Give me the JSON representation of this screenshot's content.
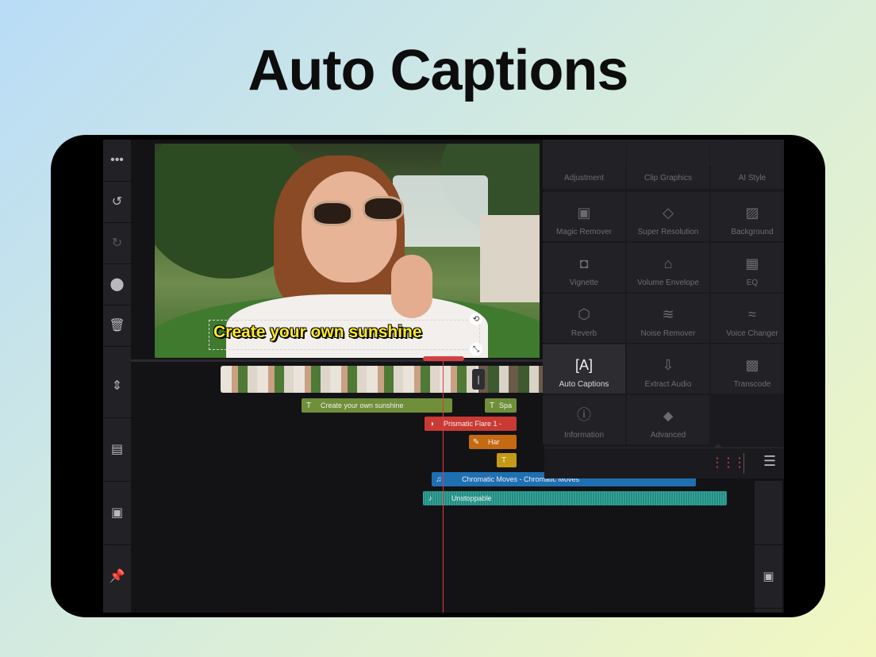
{
  "headline": "Auto Captions",
  "preview": {
    "caption": "Create your own sunshine"
  },
  "timeline": {
    "text_clip_1": "Create your own sunshine",
    "text_clip_2": "Spa",
    "effect_clip_1": "Prismatic Flare 1 -",
    "effect_clip_2": "Har",
    "audio_clip_1": "Chromatic Moves - Chromatic Moves",
    "audio_clip_2": "Unstoppable"
  },
  "panel": {
    "items": [
      {
        "label": "Adjustment",
        "icon": "adjustment-icon"
      },
      {
        "label": "Clip Graphics",
        "icon": "clip-graphics-icon"
      },
      {
        "label": "AI Style",
        "icon": "ai-style-icon"
      },
      {
        "label": "Magic Remover",
        "icon": "magic-remover-icon"
      },
      {
        "label": "Super Resolution",
        "icon": "super-resolution-icon"
      },
      {
        "label": "Background",
        "icon": "background-icon"
      },
      {
        "label": "Vignette",
        "icon": "vignette-icon"
      },
      {
        "label": "Volume Envelope",
        "icon": "volume-envelope-icon"
      },
      {
        "label": "EQ",
        "icon": "eq-icon"
      },
      {
        "label": "Reverb",
        "icon": "reverb-icon"
      },
      {
        "label": "Noise Remover",
        "icon": "noise-remover-icon"
      },
      {
        "label": "Voice Changer",
        "icon": "voice-changer-icon"
      },
      {
        "label": "Auto Captions",
        "icon": "auto-captions-icon"
      },
      {
        "label": "Extract Audio",
        "icon": "extract-audio-icon"
      },
      {
        "label": "Transcode",
        "icon": "transcode-icon"
      },
      {
        "label": "Information",
        "icon": "information-icon"
      },
      {
        "label": "Advanced",
        "icon": "advanced-icon"
      }
    ]
  },
  "colors": {
    "accent_red": "#d64040",
    "caption_yellow": "#ffeb2d",
    "text_clip": "#6f8f3a",
    "effect_red": "#c93a34",
    "effect_orange": "#c46a12",
    "effect_gold": "#c59a17",
    "audio_blue": "#1f6fb3",
    "audio_teal": "#1f8f84"
  }
}
